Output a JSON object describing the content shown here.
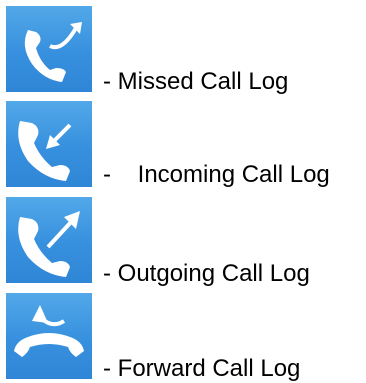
{
  "legend": {
    "items": [
      {
        "icon": "missed-call-icon",
        "label": "- Missed Call Log"
      },
      {
        "icon": "incoming-call-icon",
        "label": "-    Incoming Call Log"
      },
      {
        "icon": "outgoing-call-icon",
        "label": "- Outgoing Call Log"
      },
      {
        "icon": "forward-call-icon",
        "label": "- Forward Call Log"
      }
    ]
  },
  "colors": {
    "icon_background": "#3a92de",
    "icon_glyph": "#ffffff",
    "text": "#000000"
  }
}
